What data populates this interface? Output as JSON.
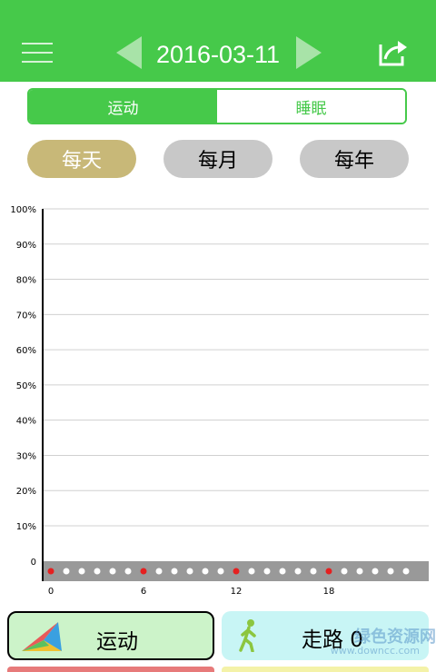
{
  "header": {
    "date": "2016-03-11",
    "menu_icon": "hamburger-menu-icon",
    "prev_icon": "triangle-left-icon",
    "next_icon": "triangle-right-icon",
    "share_icon": "share-export-icon",
    "bg_color": "#46c94a"
  },
  "segment": {
    "tabs": [
      {
        "label": "运动",
        "active": true
      },
      {
        "label": "睡眠",
        "active": false
      }
    ]
  },
  "period": {
    "buttons": [
      {
        "label": "每天",
        "active": true
      },
      {
        "label": "每月",
        "active": false
      },
      {
        "label": "每年",
        "active": false
      }
    ]
  },
  "chart_data": {
    "type": "bar",
    "title": "",
    "xlabel": "",
    "ylabel": "",
    "y_ticks": [
      "0",
      "10%",
      "20%",
      "30%",
      "40%",
      "50%",
      "60%",
      "70%",
      "80%",
      "90%",
      "100%"
    ],
    "ylim": [
      0,
      100
    ],
    "x_ticks": [
      "0",
      "6",
      "12",
      "18"
    ],
    "hours": [
      0,
      1,
      2,
      3,
      4,
      5,
      6,
      7,
      8,
      9,
      10,
      11,
      12,
      13,
      14,
      15,
      16,
      17,
      18,
      19,
      20,
      21,
      22,
      23
    ],
    "values": [
      0,
      0,
      0,
      0,
      0,
      0,
      0,
      0,
      0,
      0,
      0,
      0,
      0,
      0,
      0,
      0,
      0,
      0,
      0,
      0,
      0,
      0,
      0,
      0
    ],
    "marker_hours": [
      0,
      6,
      12,
      18
    ],
    "grid": true,
    "colors": {
      "marker": "#e52020",
      "dot": "#ffffff",
      "baseline": "#999999",
      "grid": "#d0d0d0"
    }
  },
  "cards": {
    "sport": {
      "label": "运动",
      "icon": "colorful-triangle-icon"
    },
    "walk": {
      "label": "走路 0",
      "icon": "walking-person-icon"
    }
  },
  "watermark": {
    "text": "绿色资源网",
    "url": "www.downcc.com"
  }
}
